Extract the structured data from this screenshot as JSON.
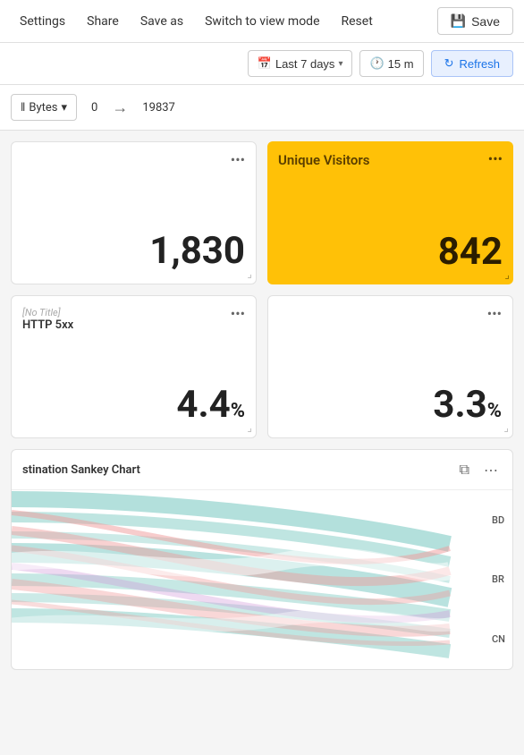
{
  "nav": {
    "items": [
      {
        "id": "settings",
        "label": "Settings"
      },
      {
        "id": "share",
        "label": "Share"
      },
      {
        "id": "save-as",
        "label": "Save as"
      },
      {
        "id": "switch-view",
        "label": "Switch to view mode"
      },
      {
        "id": "reset",
        "label": "Reset"
      }
    ],
    "save_label": "Save",
    "save_icon": "💾"
  },
  "toolbar": {
    "date_icon": "📅",
    "date_range": "Last 7 days",
    "chevron": "▾",
    "interval_icon": "🕐",
    "interval": "15 m",
    "refresh_icon": "↻",
    "refresh_label": "Refresh"
  },
  "filter_bar": {
    "dropdown_label": "Bytes",
    "dropdown_icon": "▾",
    "value_from": "0",
    "arrow": "→",
    "value_to": "19837"
  },
  "cards": [
    {
      "id": "card1",
      "title": "",
      "value": "1,830",
      "is_pct": false,
      "is_yellow": false
    },
    {
      "id": "card2",
      "title": "Unique Visitors",
      "value": "842",
      "is_pct": false,
      "is_yellow": true
    },
    {
      "id": "card3",
      "title": "[No Title]",
      "subtitle": "HTTP 5xx",
      "value": "4.4",
      "is_pct": true,
      "is_yellow": false
    },
    {
      "id": "card4",
      "title": "",
      "value": "3.3",
      "is_pct": true,
      "is_yellow": false
    }
  ],
  "sankey": {
    "title": "stination Sankey Chart",
    "labels": [
      "BD",
      "BR",
      "CN"
    ],
    "menu_icon": "⋯",
    "copy_icon": "⧉"
  },
  "menu_dots": "•••"
}
